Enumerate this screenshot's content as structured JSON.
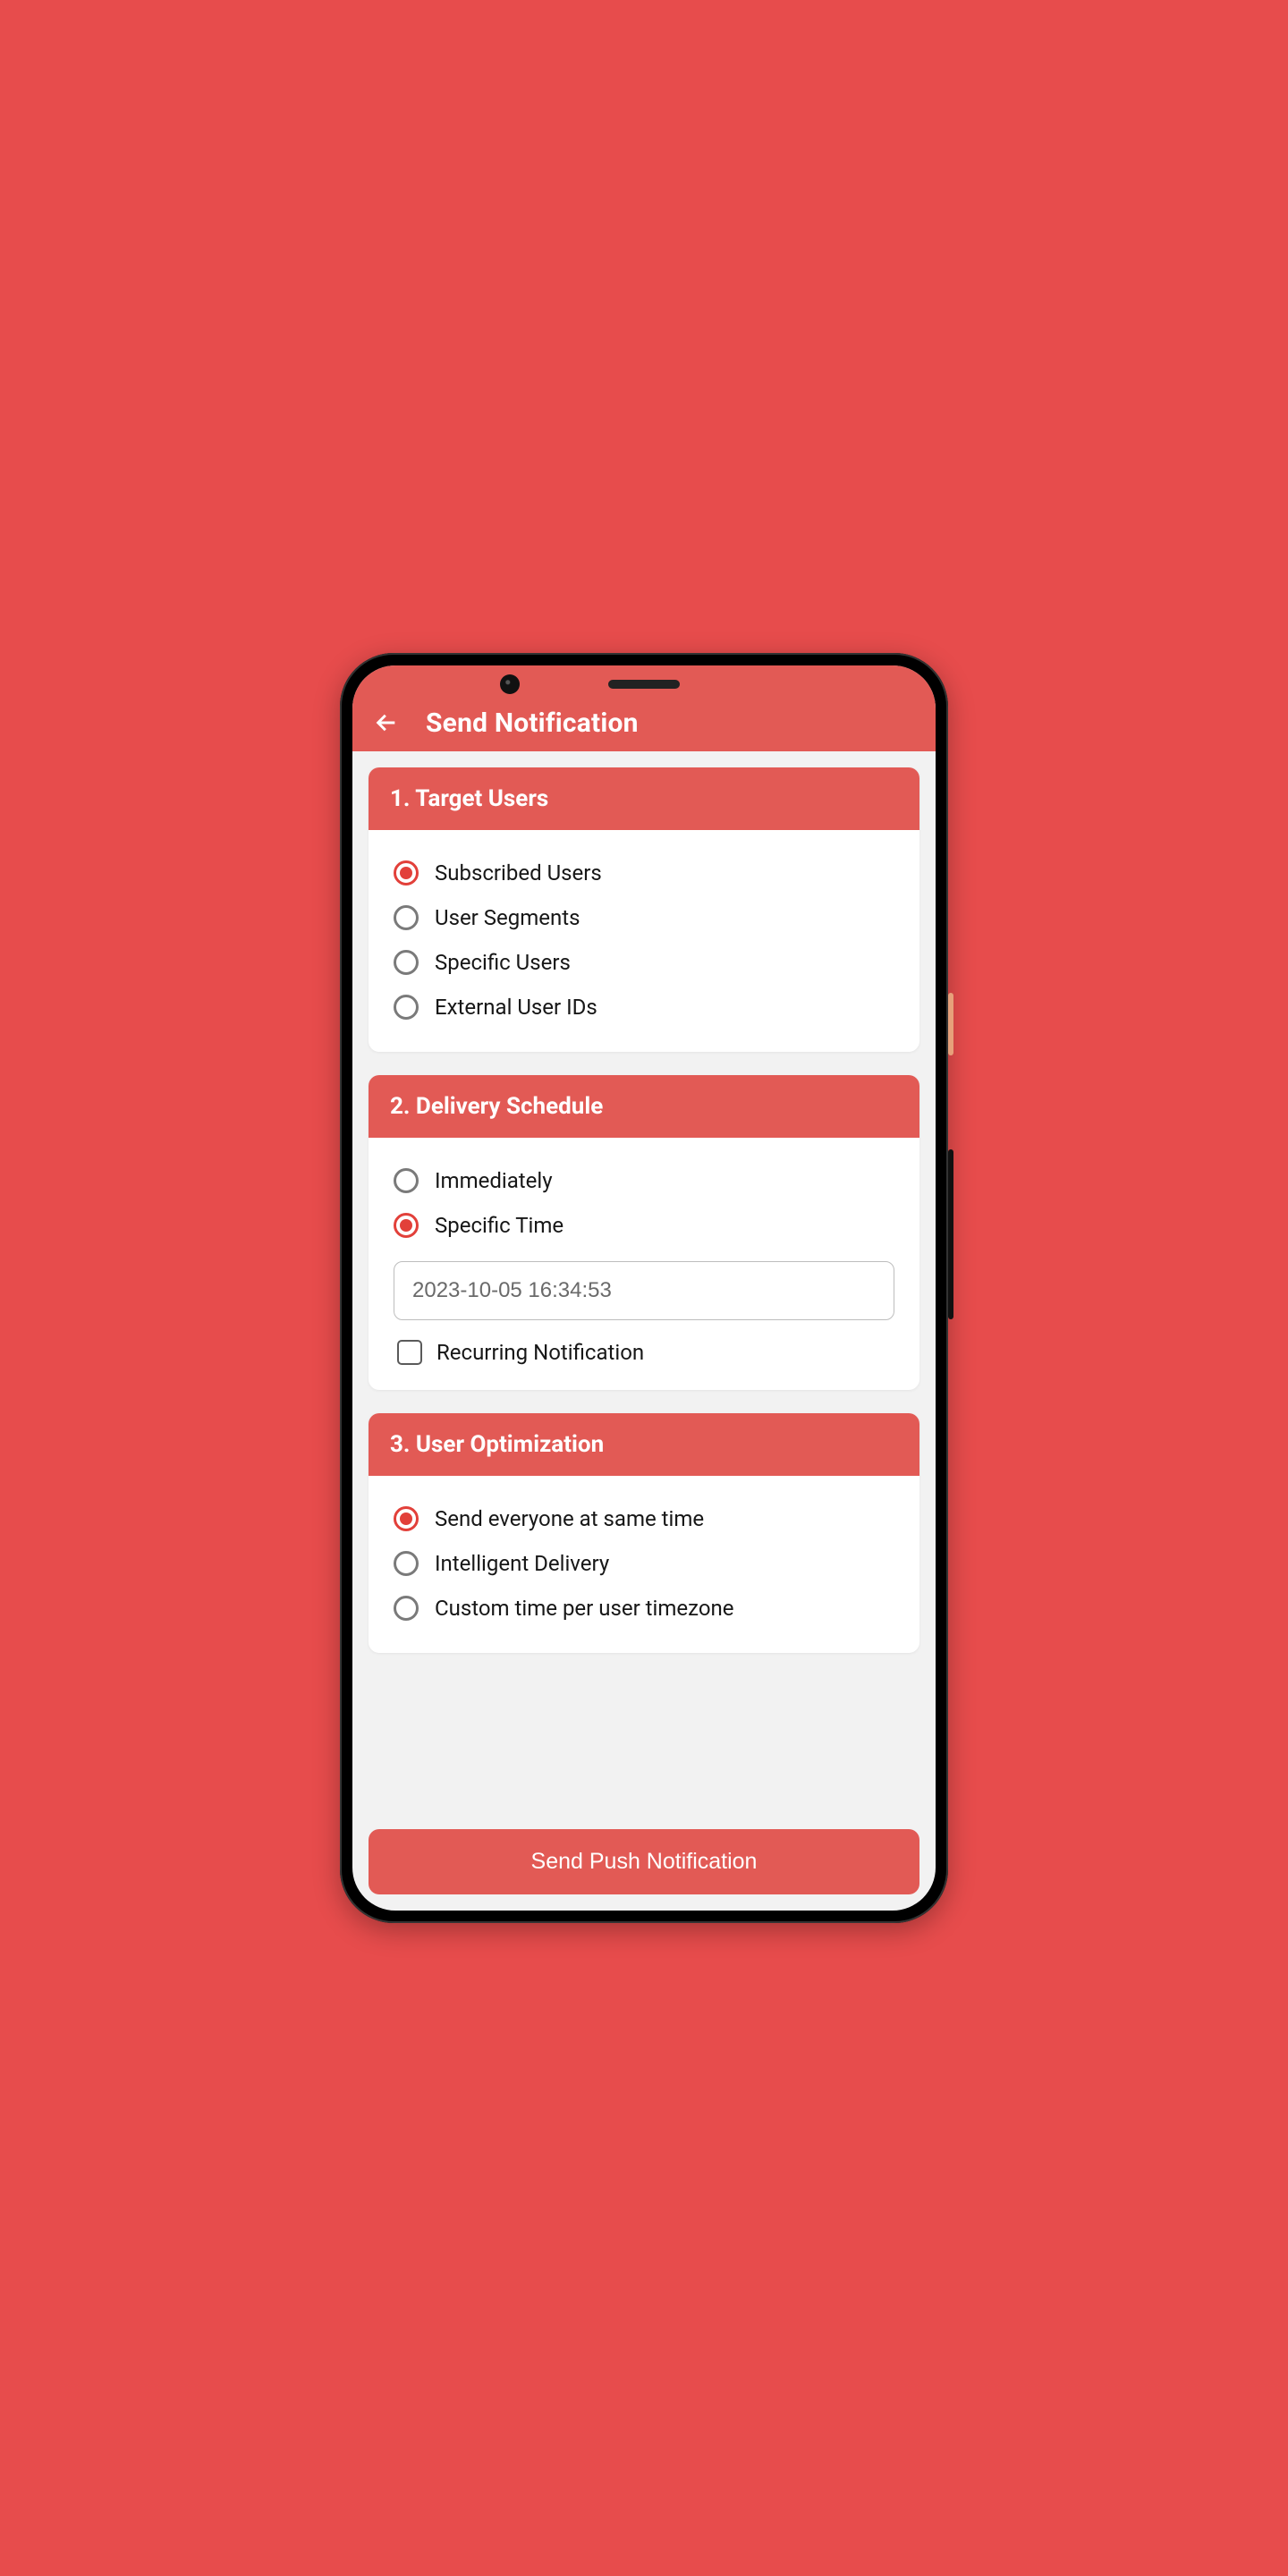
{
  "header": {
    "title": "Send Notification"
  },
  "sections": {
    "target_users": {
      "title": "1. Target Users",
      "options": [
        {
          "label": "Subscribed Users",
          "selected": true
        },
        {
          "label": "User Segments",
          "selected": false
        },
        {
          "label": "Specific Users",
          "selected": false
        },
        {
          "label": "External User IDs",
          "selected": false
        }
      ]
    },
    "delivery_schedule": {
      "title": "2. Delivery Schedule",
      "options": [
        {
          "label": "Immediately",
          "selected": false
        },
        {
          "label": "Specific Time",
          "selected": true
        }
      ],
      "datetime_value": "2023-10-05 16:34:53",
      "recurring_label": "Recurring Notification",
      "recurring_checked": false
    },
    "user_optimization": {
      "title": "3. User Optimization",
      "options": [
        {
          "label": "Send everyone at same time",
          "selected": true
        },
        {
          "label": "Intelligent Delivery",
          "selected": false
        },
        {
          "label": "Custom time per user timezone",
          "selected": false
        }
      ]
    }
  },
  "submit_label": "Send Push Notification",
  "colors": {
    "accent": "#e25a55",
    "page_bg": "#e74c4c"
  }
}
